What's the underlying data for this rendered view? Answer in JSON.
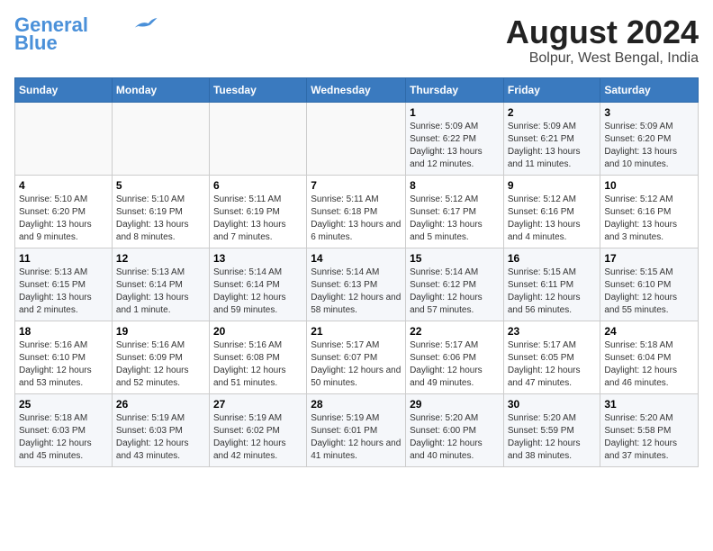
{
  "header": {
    "logo_line1": "General",
    "logo_line2": "Blue",
    "month_title": "August 2024",
    "location": "Bolpur, West Bengal, India"
  },
  "weekdays": [
    "Sunday",
    "Monday",
    "Tuesday",
    "Wednesday",
    "Thursday",
    "Friday",
    "Saturday"
  ],
  "weeks": [
    [
      {
        "day": "",
        "info": ""
      },
      {
        "day": "",
        "info": ""
      },
      {
        "day": "",
        "info": ""
      },
      {
        "day": "",
        "info": ""
      },
      {
        "day": "1",
        "info": "Sunrise: 5:09 AM\nSunset: 6:22 PM\nDaylight: 13 hours\nand 12 minutes."
      },
      {
        "day": "2",
        "info": "Sunrise: 5:09 AM\nSunset: 6:21 PM\nDaylight: 13 hours\nand 11 minutes."
      },
      {
        "day": "3",
        "info": "Sunrise: 5:09 AM\nSunset: 6:20 PM\nDaylight: 13 hours\nand 10 minutes."
      }
    ],
    [
      {
        "day": "4",
        "info": "Sunrise: 5:10 AM\nSunset: 6:20 PM\nDaylight: 13 hours\nand 9 minutes."
      },
      {
        "day": "5",
        "info": "Sunrise: 5:10 AM\nSunset: 6:19 PM\nDaylight: 13 hours\nand 8 minutes."
      },
      {
        "day": "6",
        "info": "Sunrise: 5:11 AM\nSunset: 6:19 PM\nDaylight: 13 hours\nand 7 minutes."
      },
      {
        "day": "7",
        "info": "Sunrise: 5:11 AM\nSunset: 6:18 PM\nDaylight: 13 hours\nand 6 minutes."
      },
      {
        "day": "8",
        "info": "Sunrise: 5:12 AM\nSunset: 6:17 PM\nDaylight: 13 hours\nand 5 minutes."
      },
      {
        "day": "9",
        "info": "Sunrise: 5:12 AM\nSunset: 6:16 PM\nDaylight: 13 hours\nand 4 minutes."
      },
      {
        "day": "10",
        "info": "Sunrise: 5:12 AM\nSunset: 6:16 PM\nDaylight: 13 hours\nand 3 minutes."
      }
    ],
    [
      {
        "day": "11",
        "info": "Sunrise: 5:13 AM\nSunset: 6:15 PM\nDaylight: 13 hours\nand 2 minutes."
      },
      {
        "day": "12",
        "info": "Sunrise: 5:13 AM\nSunset: 6:14 PM\nDaylight: 13 hours\nand 1 minute."
      },
      {
        "day": "13",
        "info": "Sunrise: 5:14 AM\nSunset: 6:14 PM\nDaylight: 12 hours\nand 59 minutes."
      },
      {
        "day": "14",
        "info": "Sunrise: 5:14 AM\nSunset: 6:13 PM\nDaylight: 12 hours\nand 58 minutes."
      },
      {
        "day": "15",
        "info": "Sunrise: 5:14 AM\nSunset: 6:12 PM\nDaylight: 12 hours\nand 57 minutes."
      },
      {
        "day": "16",
        "info": "Sunrise: 5:15 AM\nSunset: 6:11 PM\nDaylight: 12 hours\nand 56 minutes."
      },
      {
        "day": "17",
        "info": "Sunrise: 5:15 AM\nSunset: 6:10 PM\nDaylight: 12 hours\nand 55 minutes."
      }
    ],
    [
      {
        "day": "18",
        "info": "Sunrise: 5:16 AM\nSunset: 6:10 PM\nDaylight: 12 hours\nand 53 minutes."
      },
      {
        "day": "19",
        "info": "Sunrise: 5:16 AM\nSunset: 6:09 PM\nDaylight: 12 hours\nand 52 minutes."
      },
      {
        "day": "20",
        "info": "Sunrise: 5:16 AM\nSunset: 6:08 PM\nDaylight: 12 hours\nand 51 minutes."
      },
      {
        "day": "21",
        "info": "Sunrise: 5:17 AM\nSunset: 6:07 PM\nDaylight: 12 hours\nand 50 minutes."
      },
      {
        "day": "22",
        "info": "Sunrise: 5:17 AM\nSunset: 6:06 PM\nDaylight: 12 hours\nand 49 minutes."
      },
      {
        "day": "23",
        "info": "Sunrise: 5:17 AM\nSunset: 6:05 PM\nDaylight: 12 hours\nand 47 minutes."
      },
      {
        "day": "24",
        "info": "Sunrise: 5:18 AM\nSunset: 6:04 PM\nDaylight: 12 hours\nand 46 minutes."
      }
    ],
    [
      {
        "day": "25",
        "info": "Sunrise: 5:18 AM\nSunset: 6:03 PM\nDaylight: 12 hours\nand 45 minutes."
      },
      {
        "day": "26",
        "info": "Sunrise: 5:19 AM\nSunset: 6:03 PM\nDaylight: 12 hours\nand 43 minutes."
      },
      {
        "day": "27",
        "info": "Sunrise: 5:19 AM\nSunset: 6:02 PM\nDaylight: 12 hours\nand 42 minutes."
      },
      {
        "day": "28",
        "info": "Sunrise: 5:19 AM\nSunset: 6:01 PM\nDaylight: 12 hours\nand 41 minutes."
      },
      {
        "day": "29",
        "info": "Sunrise: 5:20 AM\nSunset: 6:00 PM\nDaylight: 12 hours\nand 40 minutes."
      },
      {
        "day": "30",
        "info": "Sunrise: 5:20 AM\nSunset: 5:59 PM\nDaylight: 12 hours\nand 38 minutes."
      },
      {
        "day": "31",
        "info": "Sunrise: 5:20 AM\nSunset: 5:58 PM\nDaylight: 12 hours\nand 37 minutes."
      }
    ]
  ]
}
